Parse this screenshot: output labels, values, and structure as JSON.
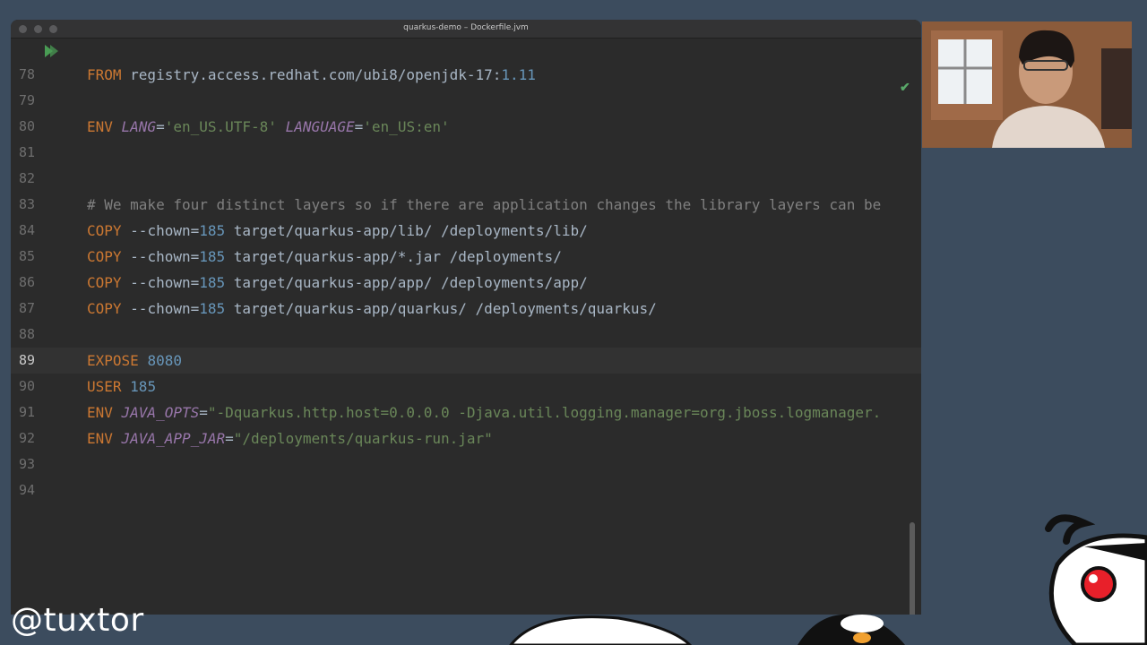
{
  "window": {
    "title": "quarkus-demo – Dockerfile.jvm"
  },
  "editor": {
    "current_line": "89",
    "lines": [
      {
        "n": "78",
        "parts": [
          [
            "kw",
            "FROM"
          ],
          [
            "t",
            " registry.access.redhat.com/ubi8/openjdk-17:"
          ],
          [
            "num",
            "1.11"
          ]
        ]
      },
      {
        "n": "79",
        "parts": []
      },
      {
        "n": "80",
        "parts": [
          [
            "kw",
            "ENV "
          ],
          [
            "var",
            "LANG"
          ],
          [
            "t",
            "="
          ],
          [
            "str",
            "'en_US.UTF-8'"
          ],
          [
            "t",
            " "
          ],
          [
            "var",
            "LANGUAGE"
          ],
          [
            "t",
            "="
          ],
          [
            "str",
            "'en_US:en'"
          ]
        ]
      },
      {
        "n": "81",
        "parts": []
      },
      {
        "n": "82",
        "parts": []
      },
      {
        "n": "83",
        "parts": [
          [
            "cm",
            "# We make four distinct layers so if there are application changes the library layers can be"
          ]
        ]
      },
      {
        "n": "84",
        "parts": [
          [
            "kw",
            "COPY "
          ],
          [
            "t",
            "--chown="
          ],
          [
            "num",
            "185"
          ],
          [
            "t",
            " target/quarkus-app/lib/ /deployments/lib/"
          ]
        ]
      },
      {
        "n": "85",
        "parts": [
          [
            "kw",
            "COPY "
          ],
          [
            "t",
            "--chown="
          ],
          [
            "num",
            "185"
          ],
          [
            "t",
            " target/quarkus-app/*.jar /deployments/"
          ]
        ]
      },
      {
        "n": "86",
        "parts": [
          [
            "kw",
            "COPY "
          ],
          [
            "t",
            "--chown="
          ],
          [
            "num",
            "185"
          ],
          [
            "t",
            " target/quarkus-app/app/ /deployments/app/"
          ]
        ]
      },
      {
        "n": "87",
        "parts": [
          [
            "kw",
            "COPY "
          ],
          [
            "t",
            "--chown="
          ],
          [
            "num",
            "185"
          ],
          [
            "t",
            " target/quarkus-app/quarkus/ /deployments/quarkus/"
          ]
        ]
      },
      {
        "n": "88",
        "parts": []
      },
      {
        "n": "89",
        "parts": [
          [
            "kw",
            "EXPOSE "
          ],
          [
            "num",
            "8080"
          ]
        ]
      },
      {
        "n": "90",
        "parts": [
          [
            "kw",
            "USER "
          ],
          [
            "num",
            "185"
          ]
        ]
      },
      {
        "n": "91",
        "parts": [
          [
            "kw",
            "ENV "
          ],
          [
            "var",
            "JAVA_OPTS"
          ],
          [
            "t",
            "="
          ],
          [
            "str",
            "\"-Dquarkus.http.host=0.0.0.0 -Djava.util.logging.manager=org.jboss.logmanager."
          ]
        ]
      },
      {
        "n": "92",
        "parts": [
          [
            "kw",
            "ENV "
          ],
          [
            "var",
            "JAVA_APP_JAR"
          ],
          [
            "t",
            "="
          ],
          [
            "str",
            "\"/deployments/quarkus-run.jar\""
          ]
        ]
      },
      {
        "n": "93",
        "parts": []
      },
      {
        "n": "94",
        "parts": []
      }
    ]
  },
  "watermark": {
    "text": "@tuxtor"
  },
  "colors": {
    "keyword": "#cc7832",
    "number": "#6897bb",
    "string": "#6a8759",
    "variable": "#9876aa",
    "comment": "#808080",
    "text": "#a9b7c6"
  },
  "icons": {
    "run": "run-gutter-icon",
    "check": "check-icon"
  }
}
